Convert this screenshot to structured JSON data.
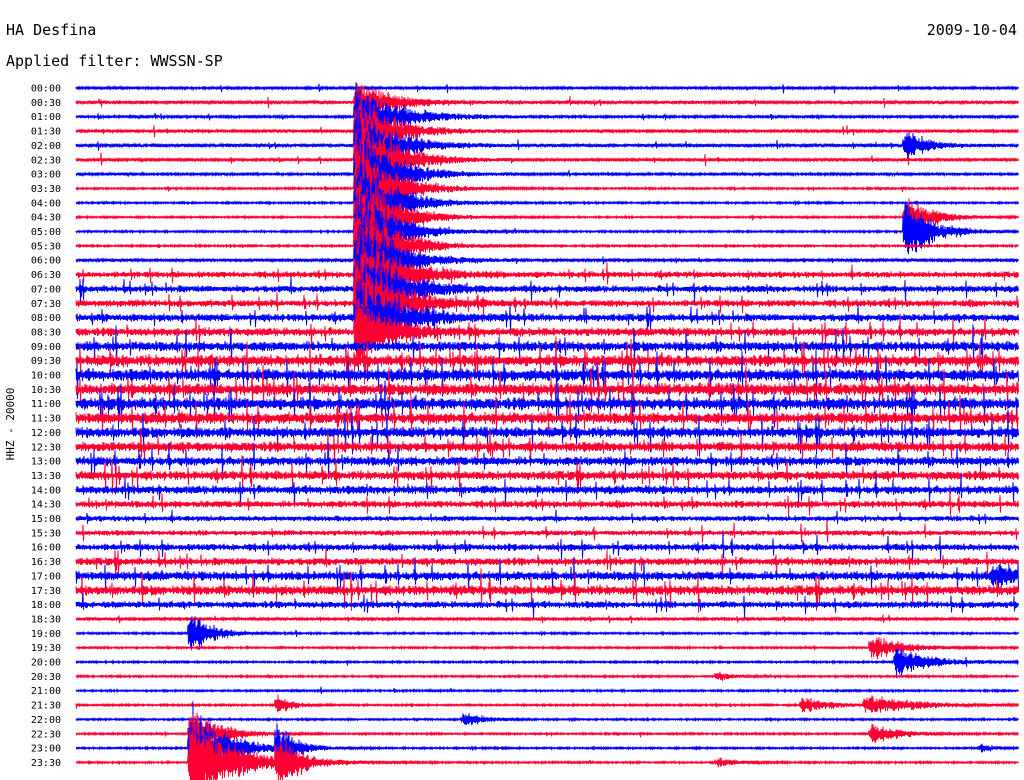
{
  "header": {
    "station": "HA Desfina",
    "date": "2009-10-04",
    "filter": "Applied filter: WWSSN-SP"
  },
  "chart_data": {
    "type": "line",
    "title": "HA Desfina",
    "subtitle": "Applied filter: WWSSN-SP",
    "date": "2009-10-04",
    "ylabel": "HHZ - 20000",
    "xlabel": "",
    "plot_kind": "helicorder",
    "trace_minutes": 30,
    "colors": [
      "#0000ff",
      "#ff0033"
    ],
    "rows": [
      {
        "time": "00:00",
        "color": "#0000ff",
        "noise": 0.35
      },
      {
        "time": "00:30",
        "color": "#ff0033",
        "noise": 0.45
      },
      {
        "time": "01:00",
        "color": "#0000ff",
        "noise": 0.35
      },
      {
        "time": "01:30",
        "color": "#ff0033",
        "noise": 0.4
      },
      {
        "time": "02:00",
        "color": "#0000ff",
        "noise": 0.45
      },
      {
        "time": "02:30",
        "color": "#ff0033",
        "noise": 0.4
      },
      {
        "time": "03:00",
        "color": "#0000ff",
        "noise": 0.35
      },
      {
        "time": "03:30",
        "color": "#ff0033",
        "noise": 0.2
      },
      {
        "time": "04:00",
        "color": "#0000ff",
        "noise": 0.2
      },
      {
        "time": "04:30",
        "color": "#ff0033",
        "noise": 0.2
      },
      {
        "time": "05:00",
        "color": "#0000ff",
        "noise": 0.25
      },
      {
        "time": "05:30",
        "color": "#ff0033",
        "noise": 0.25
      },
      {
        "time": "06:00",
        "color": "#0000ff",
        "noise": 0.4
      },
      {
        "time": "06:30",
        "color": "#ff0033",
        "noise": 0.8
      },
      {
        "time": "07:00",
        "color": "#0000ff",
        "noise": 0.9
      },
      {
        "time": "07:30",
        "color": "#ff0033",
        "noise": 0.9
      },
      {
        "time": "08:00",
        "color": "#0000ff",
        "noise": 1.0
      },
      {
        "time": "08:30",
        "color": "#ff0033",
        "noise": 1.1
      },
      {
        "time": "09:00",
        "color": "#0000ff",
        "noise": 1.3
      },
      {
        "time": "09:30",
        "color": "#ff0033",
        "noise": 1.5
      },
      {
        "time": "10:00",
        "color": "#0000ff",
        "noise": 1.6
      },
      {
        "time": "10:30",
        "color": "#ff0033",
        "noise": 1.6
      },
      {
        "time": "11:00",
        "color": "#0000ff",
        "noise": 1.6
      },
      {
        "time": "11:30",
        "color": "#ff0033",
        "noise": 1.5
      },
      {
        "time": "12:00",
        "color": "#0000ff",
        "noise": 1.4
      },
      {
        "time": "12:30",
        "color": "#ff0033",
        "noise": 1.3
      },
      {
        "time": "13:00",
        "color": "#0000ff",
        "noise": 1.2
      },
      {
        "time": "13:30",
        "color": "#ff0033",
        "noise": 1.2
      },
      {
        "time": "14:00",
        "color": "#0000ff",
        "noise": 1.1
      },
      {
        "time": "14:30",
        "color": "#ff0033",
        "noise": 0.9
      },
      {
        "time": "15:00",
        "color": "#0000ff",
        "noise": 0.7
      },
      {
        "time": "15:30",
        "color": "#ff0033",
        "noise": 0.7
      },
      {
        "time": "16:00",
        "color": "#0000ff",
        "noise": 0.9
      },
      {
        "time": "16:30",
        "color": "#ff0033",
        "noise": 1.0
      },
      {
        "time": "17:00",
        "color": "#0000ff",
        "noise": 1.2
      },
      {
        "time": "17:30",
        "color": "#ff0033",
        "noise": 1.3
      },
      {
        "time": "18:00",
        "color": "#0000ff",
        "noise": 0.9
      },
      {
        "time": "18:30",
        "color": "#ff0033",
        "noise": 0.4
      },
      {
        "time": "19:00",
        "color": "#0000ff",
        "noise": 0.2
      },
      {
        "time": "19:30",
        "color": "#ff0033",
        "noise": 0.15
      },
      {
        "time": "20:00",
        "color": "#0000ff",
        "noise": 0.15
      },
      {
        "time": "20:30",
        "color": "#ff0033",
        "noise": 0.15
      },
      {
        "time": "21:00",
        "color": "#0000ff",
        "noise": 0.15
      },
      {
        "time": "21:30",
        "color": "#ff0033",
        "noise": 0.15
      },
      {
        "time": "22:00",
        "color": "#0000ff",
        "noise": 0.15
      },
      {
        "time": "22:30",
        "color": "#ff0033",
        "noise": 0.15
      },
      {
        "time": "23:00",
        "color": "#0000ff",
        "noise": 0.15
      },
      {
        "time": "23:30",
        "color": "#ff0033",
        "noise": 0.15
      }
    ],
    "events": [
      {
        "row": "00:30",
        "minute": 8.9,
        "amp": 30,
        "dur": 1.0
      },
      {
        "row": "01:00",
        "minute": 8.9,
        "amp": 40,
        "dur": 1.2
      },
      {
        "row": "01:30",
        "minute": 8.9,
        "amp": 50,
        "dur": 1.0
      },
      {
        "row": "02:00",
        "minute": 8.9,
        "amp": 60,
        "dur": 1.0
      },
      {
        "row": "02:30",
        "minute": 8.9,
        "amp": 70,
        "dur": 1.0
      },
      {
        "row": "03:00",
        "minute": 8.9,
        "amp": 70,
        "dur": 1.0
      },
      {
        "row": "03:30",
        "minute": 8.9,
        "amp": 70,
        "dur": 1.0
      },
      {
        "row": "04:00",
        "minute": 8.9,
        "amp": 70,
        "dur": 1.0
      },
      {
        "row": "04:30",
        "minute": 8.9,
        "amp": 70,
        "dur": 1.0
      },
      {
        "row": "05:00",
        "minute": 8.9,
        "amp": 70,
        "dur": 1.0
      },
      {
        "row": "05:30",
        "minute": 8.9,
        "amp": 70,
        "dur": 1.0
      },
      {
        "row": "06:00",
        "minute": 8.9,
        "amp": 70,
        "dur": 1.0
      },
      {
        "row": "06:30",
        "minute": 8.9,
        "amp": 70,
        "dur": 1.0
      },
      {
        "row": "07:00",
        "minute": 8.9,
        "amp": 70,
        "dur": 1.0
      },
      {
        "row": "07:30",
        "minute": 8.9,
        "amp": 70,
        "dur": 1.0
      },
      {
        "row": "08:00",
        "minute": 8.9,
        "amp": 60,
        "dur": 1.0
      },
      {
        "row": "08:30",
        "minute": 8.9,
        "amp": 40,
        "dur": 1.0
      },
      {
        "row": "04:30",
        "minute": 26.4,
        "amp": 25,
        "dur": 0.8
      },
      {
        "row": "05:00",
        "minute": 26.4,
        "amp": 40,
        "dur": 0.8
      },
      {
        "row": "02:00",
        "minute": 26.4,
        "amp": 20,
        "dur": 0.6
      },
      {
        "row": "19:00",
        "minute": 3.6,
        "amp": 30,
        "dur": 0.6
      },
      {
        "row": "21:30",
        "minute": 6.4,
        "amp": 14,
        "dur": 0.4
      },
      {
        "row": "22:00",
        "minute": 12.3,
        "amp": 10,
        "dur": 0.6
      },
      {
        "row": "22:30",
        "minute": 3.6,
        "amp": 40,
        "dur": 0.8
      },
      {
        "row": "23:00",
        "minute": 3.6,
        "amp": 55,
        "dur": 1.0
      },
      {
        "row": "23:30",
        "minute": 3.6,
        "amp": 60,
        "dur": 1.3
      },
      {
        "row": "23:00",
        "minute": 6.4,
        "amp": 30,
        "dur": 0.5
      },
      {
        "row": "23:30",
        "minute": 6.4,
        "amp": 35,
        "dur": 0.6
      },
      {
        "row": "19:30",
        "minute": 25.3,
        "amp": 14,
        "dur": 1.0
      },
      {
        "row": "20:00",
        "minute": 26.1,
        "amp": 18,
        "dur": 1.0
      },
      {
        "row": "20:30",
        "minute": 20.4,
        "amp": 6,
        "dur": 0.5
      },
      {
        "row": "21:30",
        "minute": 23.1,
        "amp": 10,
        "dur": 0.8
      },
      {
        "row": "21:30",
        "minute": 25.1,
        "amp": 12,
        "dur": 1.5
      },
      {
        "row": "22:30",
        "minute": 25.3,
        "amp": 14,
        "dur": 0.8
      },
      {
        "row": "23:00",
        "minute": 28.8,
        "amp": 6,
        "dur": 0.4
      },
      {
        "row": "23:30",
        "minute": 20.4,
        "amp": 6,
        "dur": 0.6
      },
      {
        "row": "17:00",
        "minute": 29.2,
        "amp": 12,
        "dur": 0.8
      }
    ]
  }
}
